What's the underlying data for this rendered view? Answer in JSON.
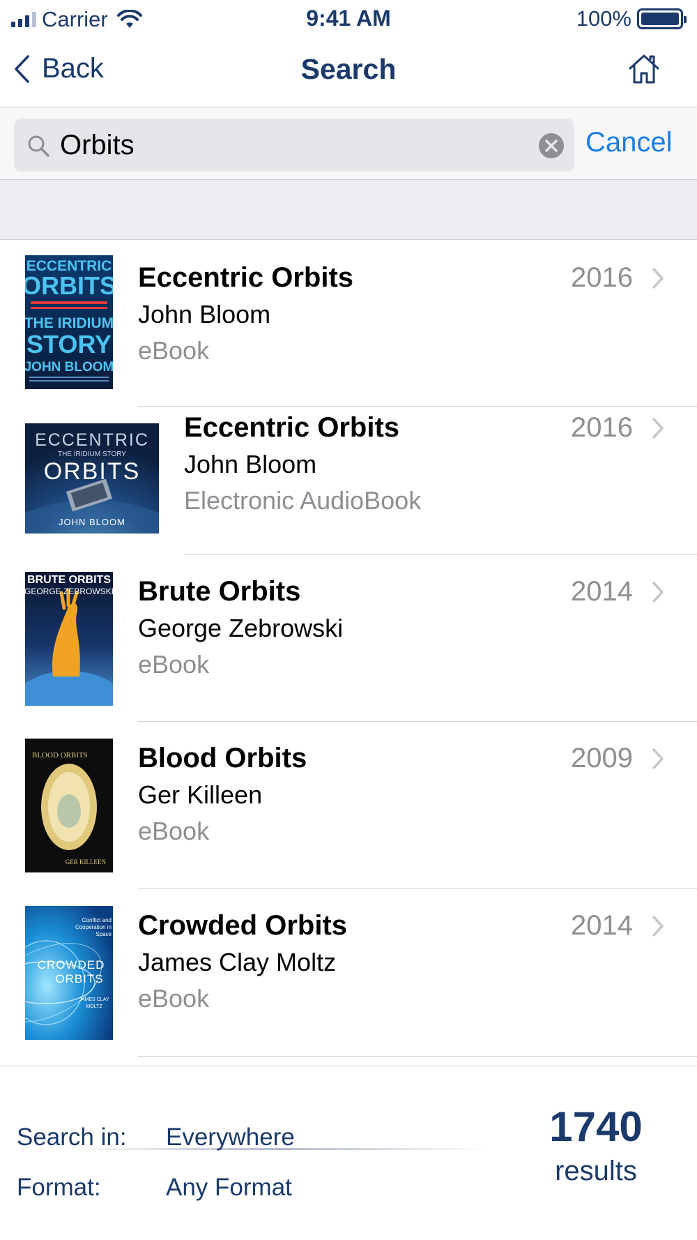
{
  "status_bar": {
    "carrier": "Carrier",
    "time": "9:41 AM",
    "battery": "100%"
  },
  "nav": {
    "back_label": "Back",
    "title": "Search",
    "home_icon": "home-icon"
  },
  "search": {
    "value": "Orbits",
    "cancel_label": "Cancel"
  },
  "results": [
    {
      "title": "Eccentric Orbits",
      "author": "John Bloom",
      "format": "eBook",
      "year": "2016",
      "cover": {
        "lines": [
          "ECCENTRIC",
          "ORBITS",
          "THE IRIDIUM",
          "STORY",
          "JOHN BLOOM"
        ]
      }
    },
    {
      "title": "Eccentric Orbits",
      "author": "John Bloom",
      "format": "Electronic AudioBook",
      "year": "2016",
      "cover": {
        "lines": [
          "ECCENTRIC",
          "THE IRIDIUM STORY",
          "ORBITS",
          "JOHN BLOOM"
        ]
      }
    },
    {
      "title": "Brute Orbits",
      "author": "George Zebrowski",
      "format": "eBook",
      "year": "2014",
      "cover": {
        "lines": [
          "BRUTE ORBITS",
          "GEORGE ZEBROWSKI"
        ]
      }
    },
    {
      "title": "Blood Orbits",
      "author": "Ger Killeen",
      "format": "eBook",
      "year": "2009",
      "cover": {
        "lines": [
          "BLOOD ORBITS",
          "GER KILLEEN"
        ]
      }
    },
    {
      "title": "Crowded Orbits",
      "author": "James Clay Moltz",
      "format": "eBook",
      "year": "2014",
      "cover": {
        "lines": [
          "Conflict and Cooperation in Space",
          "CROWDED",
          "ORBITS",
          "JAMES CLAY MOLTZ"
        ]
      }
    }
  ],
  "footer": {
    "search_in_label": "Search in:",
    "search_in_value": "Everywhere",
    "format_label": "Format:",
    "format_value": "Any Format",
    "count": "1740",
    "count_label": "results"
  }
}
